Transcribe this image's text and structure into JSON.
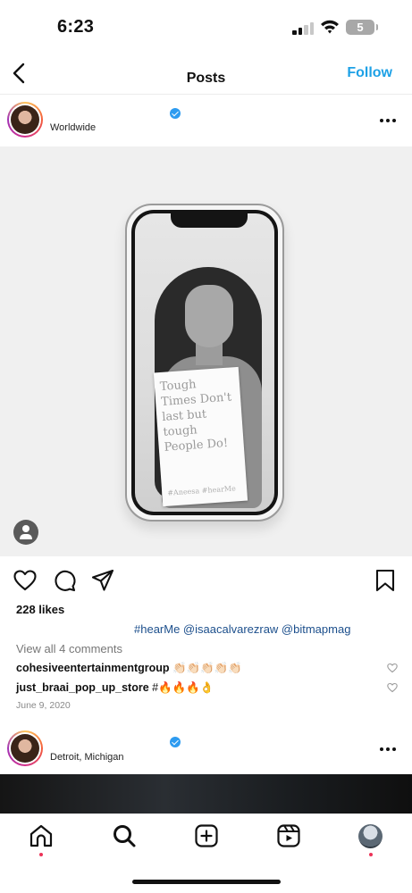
{
  "status_bar": {
    "time": "6:23",
    "battery": "5"
  },
  "header": {
    "title": "Posts",
    "follow_label": "Follow"
  },
  "post1": {
    "location": "Worldwide",
    "sign_text": "Tough Times Don't last but tough People Do!",
    "sign_tags": "#Aneesa  #hearMe",
    "likes": "228 likes",
    "caption_tags": "#hearMe @isaacalvarezraw @bitmapmag",
    "view_comments": "View all 4 comments",
    "comments": [
      {
        "username": "cohesiveentertainmentgroup",
        "text": "👏🏻👏🏻👏🏻👏🏻👏🏻"
      },
      {
        "username": "just_braai_pop_up_store",
        "text": "#🔥🔥🔥👌"
      }
    ],
    "date": "June 9, 2020"
  },
  "post2": {
    "location": "Detroit, Michigan"
  },
  "tabs": [
    "home-icon",
    "search-icon",
    "create-icon",
    "reels-icon",
    "profile-avatar"
  ],
  "colors": {
    "follow": "#1ea1e6",
    "verified": "#2d9bf0",
    "hashtag": "#1c4f8c",
    "notification_dot": "#ec3257"
  }
}
